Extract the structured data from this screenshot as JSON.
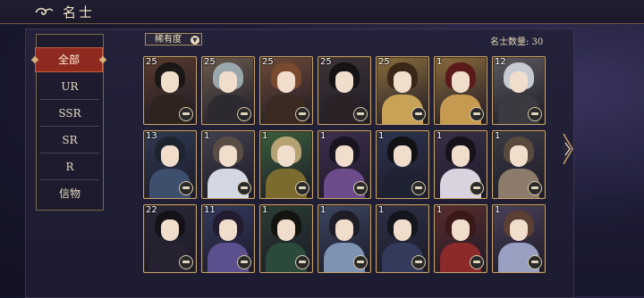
{
  "header": {
    "title": "名士",
    "back_icon": "swirl-back-icon"
  },
  "sidebar": {
    "tabs": [
      {
        "label": "全部",
        "active": true
      },
      {
        "label": "UR"
      },
      {
        "label": "SSR"
      },
      {
        "label": "SR"
      },
      {
        "label": "R"
      },
      {
        "label": "信物"
      }
    ]
  },
  "toolbar": {
    "sort_label": "稀有度",
    "sort_icon": "chevron-down-icon"
  },
  "summary": {
    "count_text": "名士数量: 30"
  },
  "cards": [
    {
      "level": "25",
      "theme": "#5a3b2c",
      "hair": "#1b1716",
      "body": "#2f2320"
    },
    {
      "level": "25",
      "theme": "#6b5b4e",
      "hair": "#9aa7ad",
      "body": "#2d2930"
    },
    {
      "level": "25",
      "theme": "#6e4a36",
      "hair": "#7a4a2e",
      "body": "#3a2a22"
    },
    {
      "level": "25",
      "theme": "#3f3436",
      "hair": "#141214",
      "body": "#2a2226"
    },
    {
      "level": "25",
      "theme": "#8a6d3c",
      "hair": "#3b2718",
      "body": "#c8a257"
    },
    {
      "level": "1",
      "theme": "#8a6a3a",
      "hair": "#5b1a1a",
      "body": "#c79a52"
    },
    {
      "level": "12",
      "theme": "#5d5a5f",
      "hair": "#c6cad2",
      "body": "#3b3a40"
    },
    {
      "level": "13",
      "theme": "#2f3a52",
      "hair": "#1d2430",
      "body": "#3e4f6e"
    },
    {
      "level": "1",
      "theme": "#42404c",
      "hair": "#5a4d45",
      "body": "#d4d8e2"
    },
    {
      "level": "1",
      "theme": "#3a5e3b",
      "hair": "#b6a173",
      "body": "#7b6b2f"
    },
    {
      "level": "1",
      "theme": "#3e2e4e",
      "hair": "#1a1420",
      "body": "#6b4b8a"
    },
    {
      "level": "1",
      "theme": "#2d3450",
      "hair": "#121214",
      "body": "#1f2233"
    },
    {
      "level": "1",
      "theme": "#3a2f48",
      "hair": "#171219",
      "body": "#d9d3df"
    },
    {
      "level": "1",
      "theme": "#3a3a44",
      "hair": "#5a4a3d",
      "body": "#8c7a6a"
    },
    {
      "level": "22",
      "theme": "#2a2636",
      "hair": "#141216",
      "body": "#262231"
    },
    {
      "level": "11",
      "theme": "#343a5e",
      "hair": "#231b2f",
      "body": "#5b4f8e"
    },
    {
      "level": "1",
      "theme": "#2a3d33",
      "hair": "#13130f",
      "body": "#2c4a3b"
    },
    {
      "level": "1",
      "theme": "#3b4660",
      "hair": "#1e1c26",
      "body": "#7e92b2"
    },
    {
      "level": "1",
      "theme": "#2d3148",
      "hair": "#15151d",
      "body": "#333a5c"
    },
    {
      "level": "1",
      "theme": "#5a2d2d",
      "hair": "#3b1818",
      "body": "#8c2a2a"
    },
    {
      "level": "1",
      "theme": "#4a4058",
      "hair": "#5b3e34",
      "body": "#9aa0c2"
    }
  ]
}
